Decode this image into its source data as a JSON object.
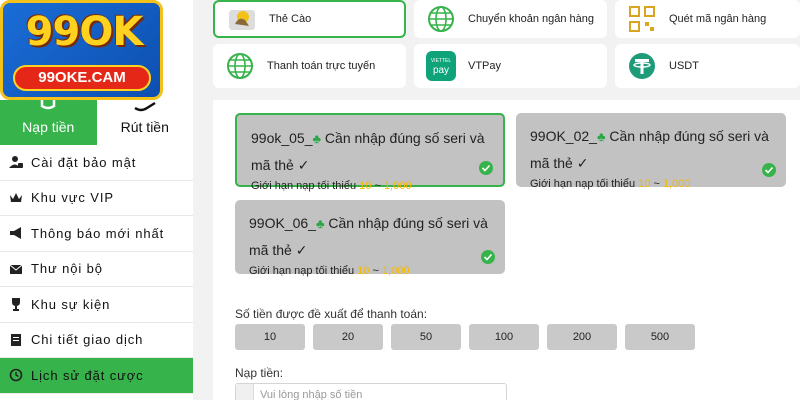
{
  "logo": {
    "main": "99OK",
    "sub": "99OKE.CAM"
  },
  "tabs": {
    "deposit": "Nạp tiền",
    "withdraw": "Rút tiền"
  },
  "menu": [
    {
      "label": "Cài đặt bảo mật",
      "icon": "user-shield-icon"
    },
    {
      "label": "Khu vực VIP",
      "icon": "crown-icon"
    },
    {
      "label": "Thông báo mới nhất",
      "icon": "megaphone-icon"
    },
    {
      "label": "Thư nội bộ",
      "icon": "mail-icon"
    },
    {
      "label": "Khu sự kiện",
      "icon": "trophy-icon"
    },
    {
      "label": "Chi tiết giao dịch",
      "icon": "receipt-icon"
    },
    {
      "label": "Lịch sử đặt cược",
      "icon": "history-icon"
    }
  ],
  "methods": [
    {
      "label": "Thẻ Cào",
      "icon": "card-icon"
    },
    {
      "label": "Chuyển khoản ngân hàng",
      "icon": "globe-icon"
    },
    {
      "label": "Quét mã ngân hàng",
      "icon": "qr-icon"
    },
    {
      "label": "Thanh toán trực tuyến",
      "icon": "globe-icon"
    },
    {
      "label": "VTPay",
      "icon": "vtpay-icon"
    },
    {
      "label": "USDT",
      "icon": "tether-icon"
    }
  ],
  "vtpay_logo": {
    "top": "VIETTEL",
    "bottom": "pay"
  },
  "channels": [
    {
      "name": "99ok_05_",
      "note": " Cần nhập đúng số seri và mã thẻ ✓",
      "limit_label": "Giới hạn nạp tối thiểu",
      "min": "10",
      "sep": "~",
      "max": "1,000"
    },
    {
      "name": "99OK_02_",
      "note": " Cần nhập đúng số seri và mã thẻ ✓",
      "limit_label": "Giới hạn nạp tối thiểu",
      "min": "10",
      "sep": "~",
      "max": "1,000"
    },
    {
      "name": "99OK_06_",
      "note": " Cần nhập đúng số seri và mã thẻ ✓",
      "limit_label": "Giới hạn nạp tối thiểu",
      "min": "10",
      "sep": "~",
      "max": "1,000"
    }
  ],
  "suggest": {
    "label": "Số tiền được đề xuất để thanh toán:",
    "amounts": [
      "10",
      "20",
      "50",
      "100",
      "200",
      "500"
    ]
  },
  "deposit": {
    "label": "Nạp tiền:",
    "placeholder": "Vui lòng nhập số tiền"
  },
  "colors": {
    "accent": "#36b34a",
    "limit_number": "#f5b800",
    "card": "#c2c2c2"
  }
}
